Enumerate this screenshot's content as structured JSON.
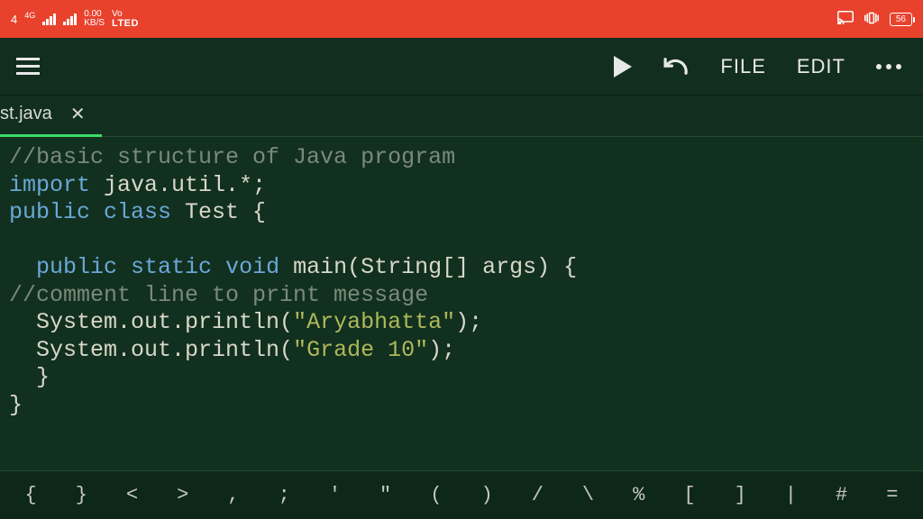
{
  "status_bar": {
    "clock_fragment": "4",
    "net_speed_top": "0.00",
    "net_speed_bottom": "KB/S",
    "network_gen": "4G",
    "volte": "Vo",
    "lte": "LTED",
    "battery": "56"
  },
  "toolbar": {
    "file_label": "FILE",
    "edit_label": "EDIT"
  },
  "tab": {
    "filename": "st.java"
  },
  "code": {
    "l1_comment": "//basic structure of Java program",
    "l2_kw": "import",
    "l2_rest": " java.util.*;",
    "l3_kw1": "public",
    "l3_kw2": "class",
    "l3_rest": " Test {",
    "l4": "",
    "l5_indent": "  ",
    "l5_kw1": "public",
    "l5_kw2": "static",
    "l5_kw3": "void",
    "l5_rest": " main(String[] args) {",
    "l6_comment": "//comment line to print message",
    "l7_pre": "  System.out.println(",
    "l7_str": "\"Aryabhatta\"",
    "l7_post": ");",
    "l8_pre": "  System.out.println(",
    "l8_str": "\"Grade 10\"",
    "l8_post": ");",
    "l9": "  }",
    "l10": "}"
  },
  "symbols": [
    "{",
    "}",
    "<",
    ">",
    ",",
    ";",
    "'",
    "\"",
    "(",
    ")",
    "/",
    "\\",
    "%",
    "[",
    "]",
    "|",
    "#",
    "="
  ]
}
